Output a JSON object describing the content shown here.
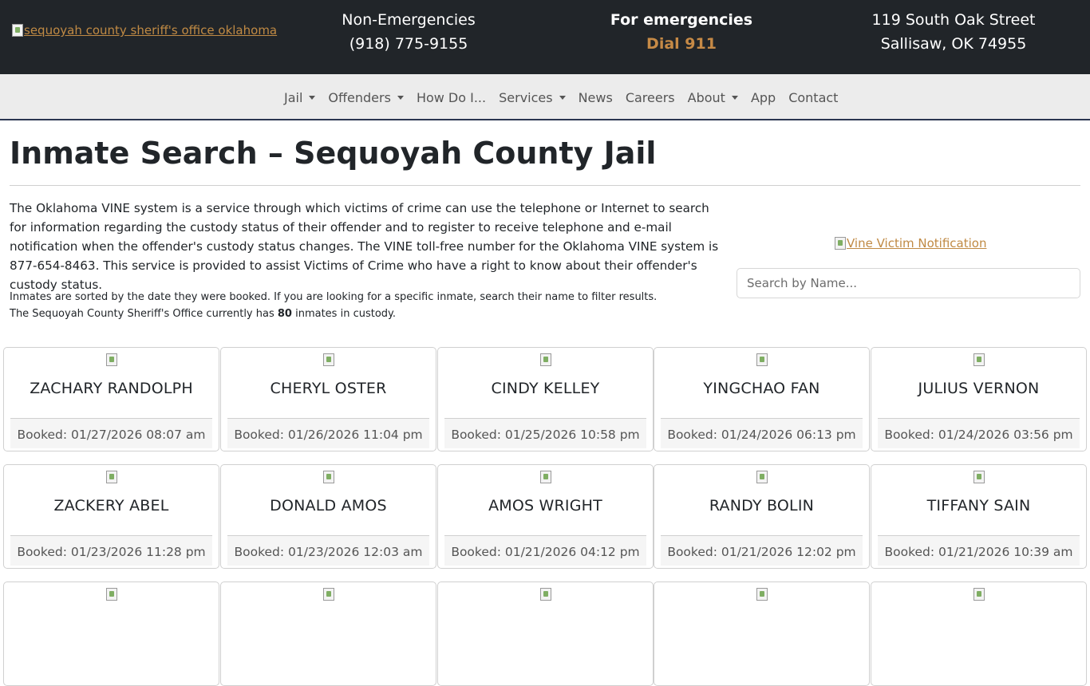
{
  "header": {
    "logo_alt": "sequoyah county sheriff's office oklahoma",
    "non_emergency": {
      "label": "Non-Emergencies",
      "phone": "(918) 775-9155"
    },
    "emergency": {
      "label": "For emergencies",
      "dial": "Dial 911"
    },
    "address": {
      "line1": "119 South Oak Street",
      "line2": "Sallisaw, OK 74955"
    },
    "accent_color": "#c68a46"
  },
  "nav": {
    "items": [
      {
        "label": "Jail",
        "dropdown": true
      },
      {
        "label": "Offenders",
        "dropdown": true
      },
      {
        "label": "How Do I...",
        "dropdown": false
      },
      {
        "label": "Services",
        "dropdown": true
      },
      {
        "label": "News",
        "dropdown": false
      },
      {
        "label": "Careers",
        "dropdown": false
      },
      {
        "label": "About",
        "dropdown": true
      },
      {
        "label": "App",
        "dropdown": false
      },
      {
        "label": "Contact",
        "dropdown": false
      }
    ]
  },
  "page": {
    "title": "Inmate Search – Sequoyah County Jail",
    "intro": "The Oklahoma VINE system is a service through which victims of crime can use the telephone or Internet to search for information regarding the custody status of their offender and to register to receive telephone and e-mail notification when the offender's custody status changes. The VINE toll-free number for the Oklahoma VINE system is 877-654-8463. This service is provided to assist Victims of Crime who have a right to know about their offender's custody status.",
    "sort_note": "Inmates are sorted by the date they were booked. If you are looking for a specific inmate, search their name to filter results.",
    "count_prefix": "The Sequoyah County Sheriff's Office currently has ",
    "count": "80",
    "count_suffix": " inmates in custody.",
    "vine_alt": "Vine Victim Notification",
    "search_placeholder": "Search by Name..."
  },
  "inmates": [
    {
      "name": "ZACHARY RANDOLPH",
      "booked": "Booked: 01/27/2026 08:07 am"
    },
    {
      "name": "CHERYL OSTER",
      "booked": "Booked: 01/26/2026 11:04 pm"
    },
    {
      "name": "CINDY KELLEY",
      "booked": "Booked: 01/25/2026 10:58 pm"
    },
    {
      "name": "YINGCHAO FAN",
      "booked": "Booked: 01/24/2026 06:13 pm"
    },
    {
      "name": "JULIUS VERNON",
      "booked": "Booked: 01/24/2026 03:56 pm"
    },
    {
      "name": "ZACKERY ABEL",
      "booked": "Booked: 01/23/2026 11:28 pm"
    },
    {
      "name": "DONALD AMOS",
      "booked": "Booked: 01/23/2026 12:03 am"
    },
    {
      "name": "AMOS WRIGHT",
      "booked": "Booked: 01/21/2026 04:12 pm"
    },
    {
      "name": "RANDY BOLIN",
      "booked": "Booked: 01/21/2026 12:02 pm"
    },
    {
      "name": "TIFFANY SAIN",
      "booked": "Booked: 01/21/2026 10:39 am"
    },
    {
      "name": "",
      "booked": ""
    },
    {
      "name": "",
      "booked": ""
    },
    {
      "name": "",
      "booked": ""
    },
    {
      "name": "",
      "booked": ""
    },
    {
      "name": "",
      "booked": ""
    }
  ]
}
